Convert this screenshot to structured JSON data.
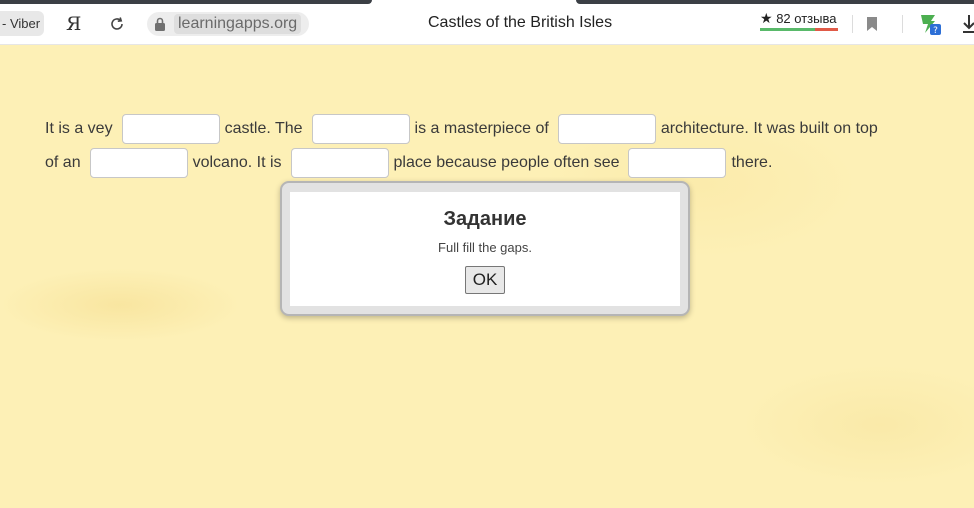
{
  "browser": {
    "tab_fragment": "- Viber",
    "yandex_glyph": "Я",
    "url": "learningapps.org",
    "page_title": "Castles of the British Isles",
    "rating": {
      "star": "★",
      "text": "82 отзыва",
      "positive_fraction": 0.7
    },
    "icons": [
      "reload-icon",
      "lock-icon",
      "bookmark-icon",
      "extension-icon",
      "download-icon"
    ]
  },
  "exercise": {
    "line1": {
      "t1": "It is a vey",
      "t2": "castle. The",
      "t3": "is a masterpiece of",
      "t4": "architecture. It was built on top"
    },
    "line2": {
      "t1": "of an",
      "t2": "volcano. It is",
      "t3": "place because people often see",
      "t4": "there."
    },
    "gaps": [
      "",
      "",
      "",
      "",
      "",
      ""
    ]
  },
  "modal": {
    "title": "Задание",
    "text": "Full fill the gaps.",
    "ok_label": "OK"
  },
  "colors": {
    "page_background": "#fdf0b6",
    "rating_positive": "#59b96a",
    "rating_negative": "#e05a47"
  }
}
